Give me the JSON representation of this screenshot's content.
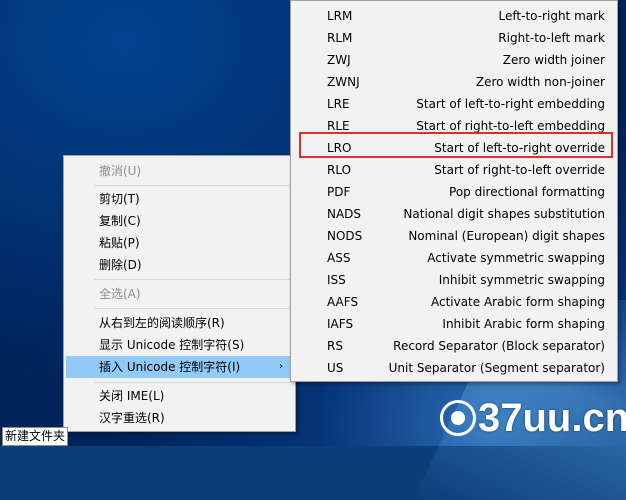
{
  "context_menu": {
    "items": [
      {
        "label": "撤消(U)",
        "disabled": true
      },
      {
        "label": "剪切(T)",
        "disabled": false
      },
      {
        "label": "复制(C)",
        "disabled": false
      },
      {
        "label": "粘贴(P)",
        "disabled": false
      },
      {
        "label": "删除(D)",
        "disabled": false
      },
      {
        "label": "全选(A)",
        "disabled": true
      },
      {
        "label": "从右到左的阅读顺序(R)",
        "disabled": false
      },
      {
        "label": "显示 Unicode 控制字符(S)",
        "disabled": false
      },
      {
        "label": "插入 Unicode 控制字符(I)",
        "disabled": false,
        "highlighted": true,
        "submenu_arrow": "›"
      },
      {
        "label": "关闭 IME(L)",
        "disabled": false
      },
      {
        "label": "汉字重选(R)",
        "disabled": false
      }
    ]
  },
  "submenu": {
    "items": [
      {
        "code": "LRM",
        "desc": "Left-to-right mark"
      },
      {
        "code": "RLM",
        "desc": "Right-to-left mark"
      },
      {
        "code": "ZWJ",
        "desc": "Zero width joiner"
      },
      {
        "code": "ZWNJ",
        "desc": "Zero width non-joiner"
      },
      {
        "code": "LRE",
        "desc": "Start of left-to-right embedding"
      },
      {
        "code": "RLE",
        "desc": "Start of right-to-left embedding"
      },
      {
        "code": "LRO",
        "desc": "Start of left-to-right override",
        "boxed": true
      },
      {
        "code": "RLO",
        "desc": "Start of right-to-left override"
      },
      {
        "code": "PDF",
        "desc": "Pop directional formatting"
      },
      {
        "code": "NADS",
        "desc": "National digit shapes substitution"
      },
      {
        "code": "NODS",
        "desc": "Nominal (European) digit shapes"
      },
      {
        "code": "ASS",
        "desc": "Activate symmetric swapping"
      },
      {
        "code": "ISS",
        "desc": "Inhibit symmetric swapping"
      },
      {
        "code": "AAFS",
        "desc": "Activate Arabic form shaping"
      },
      {
        "code": "IAFS",
        "desc": "Inhibit Arabic form shaping"
      },
      {
        "code": "RS",
        "desc": "Record Separator (Block separator)"
      },
      {
        "code": "US",
        "desc": "Unit Separator (Segment separator)"
      }
    ],
    "highlight_color": "#d9302b"
  },
  "desktop": {
    "rename_field_value": "新建文件夹",
    "watermark": "37uu.cn"
  }
}
